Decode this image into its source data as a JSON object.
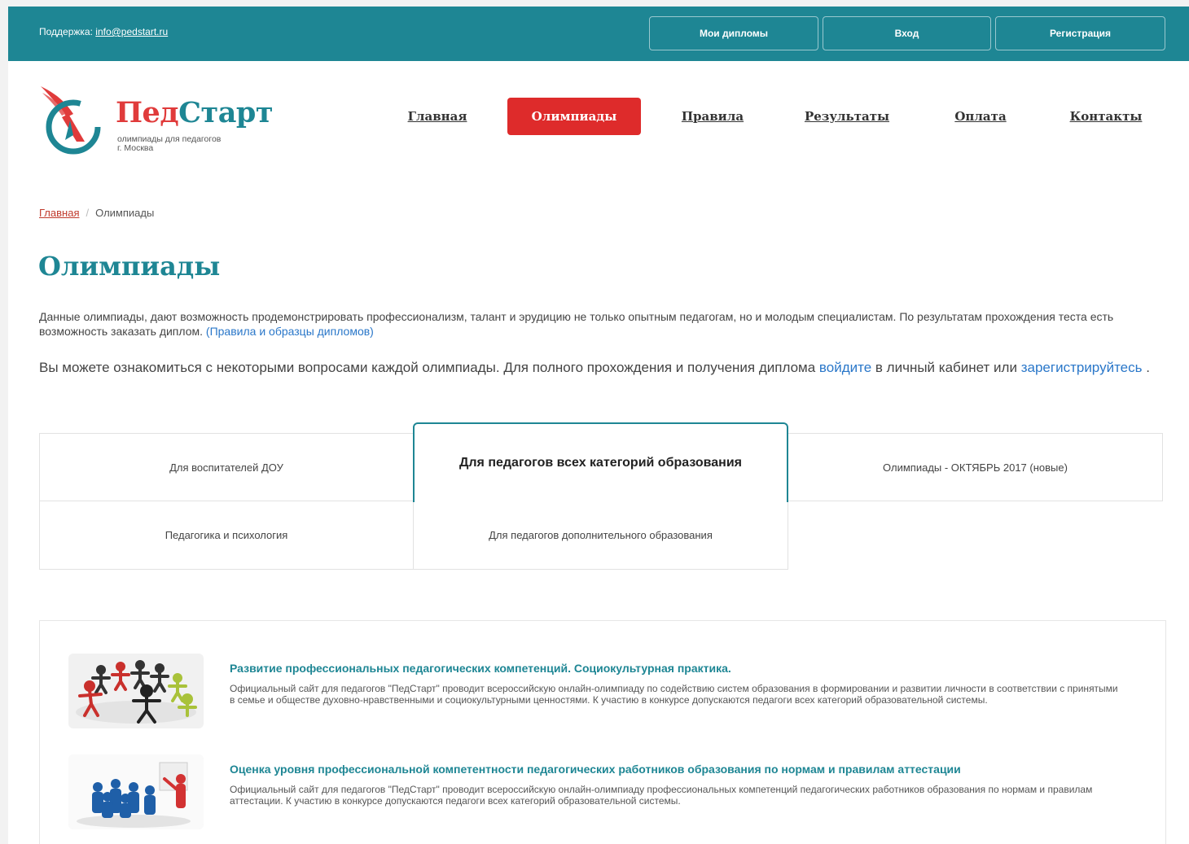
{
  "topbar": {
    "support_label": "Поддержка:",
    "support_email": "info@pedstart.ru",
    "buttons": [
      "Мои дипломы",
      "Вход",
      "Регистрация"
    ]
  },
  "logo": {
    "title_part1": "Пед",
    "title_part2": "Старт",
    "subtitle_line1": "олимпиады для педагогов",
    "subtitle_line2": "г. Москва"
  },
  "nav": [
    "Главная",
    "Олимпиады",
    "Правила",
    "Результаты",
    "Оплата",
    "Контакты"
  ],
  "breadcrumb": {
    "home": "Главная",
    "current": "Олимпиады"
  },
  "page_title": "Олимпиады",
  "intro": {
    "text": "Данные олимпиады, дают возможность продемонстрировать профессионализм, талант и эрудицию не только опытным педагогам, но и молодым специалистам. По результатам прохождения теста есть возможность заказать диплом.",
    "link": "(Правила и образцы дипломов)"
  },
  "intro2": {
    "text_before": "Вы можете ознакомиться с некоторыми вопросами каждой олимпиады. Для полного прохождения и получения диплома",
    "login_link": "войдите",
    "text_middle": "в личный кабинет или",
    "register_link": "зарегистрируйтесь",
    "text_after": "."
  },
  "tabs": {
    "row1": [
      "Для воспитателей ДОУ",
      "Для педагогов всех категорий образования",
      "Олимпиады - ОКТЯБРЬ 2017 (новые)"
    ],
    "row2": [
      "Педагогика и психология",
      "Для педагогов дополнительного образования"
    ]
  },
  "items": [
    {
      "title": "Развитие профессиональных педагогических компетенций. Социокультурная практика.",
      "description": "Официальный сайт для педагогов \"ПедСтарт\" проводит всероссийскую онлайн-олимпиаду по содействию систем образования в формировании и развитии личности в соответствии с принятыми в семье и обществе духовно-нравственными и социокультурными ценностями. К участию в конкурсе допускаются педагоги всех категорий образовательной системы."
    },
    {
      "title": "Оценка уровня профессиональной компетентности педагогических работников образования по нормам и правилам аттестации",
      "description": "Официальный сайт для педагогов \"ПедСтарт\" проводит всероссийскую онлайн-олимпиаду профессиональных компетенций педагогических работников образования по нормам и правилам аттестации. К участию в конкурсе допускаются педагоги всех категорий образовательной системы."
    }
  ],
  "colors": {
    "brand": "#1e8694",
    "accent": "#de2b2b",
    "link": "#2a77c9"
  }
}
